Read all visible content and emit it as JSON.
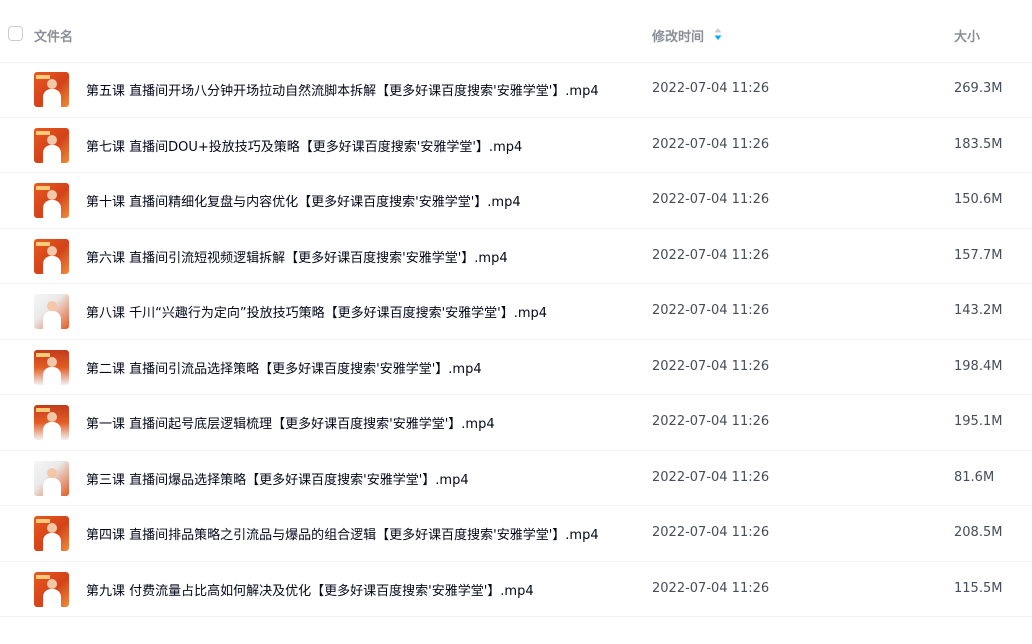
{
  "header": {
    "name_label": "文件名",
    "time_label": "修改时间",
    "size_label": "大小"
  },
  "colors": {
    "sort_active": "#06a7ff",
    "sort_inactive": "#c9ccd3",
    "thumb_orange": "#e35b24"
  },
  "files": [
    {
      "name": "第五课 直播间开场八分钟开场拉动自然流脚本拆解【更多好课百度搜索'安雅学堂'】.mp4",
      "time": "2022-07-04 11:26",
      "size": "269.3M"
    },
    {
      "name": "第七课 直播间DOU+投放技巧及策略【更多好课百度搜索'安雅学堂'】.mp4",
      "time": "2022-07-04 11:26",
      "size": "183.5M"
    },
    {
      "name": "第十课 直播间精细化复盘与内容优化【更多好课百度搜索'安雅学堂'】.mp4",
      "time": "2022-07-04 11:26",
      "size": "150.6M"
    },
    {
      "name": "第六课 直播间引流短视频逻辑拆解【更多好课百度搜索'安雅学堂'】.mp4",
      "time": "2022-07-04 11:26",
      "size": "157.7M"
    },
    {
      "name": "第八课 千川“兴趣行为定向”投放技巧策略【更多好课百度搜索'安雅学堂'】.mp4",
      "time": "2022-07-04 11:26",
      "size": "143.2M"
    },
    {
      "name": "第二课 直播间引流品选择策略【更多好课百度搜索'安雅学堂'】.mp4",
      "time": "2022-07-04 11:26",
      "size": "198.4M"
    },
    {
      "name": "第一课 直播间起号底层逻辑梳理【更多好课百度搜索'安雅学堂'】.mp4",
      "time": "2022-07-04 11:26",
      "size": "195.1M"
    },
    {
      "name": "第三课 直播间爆品选择策略【更多好课百度搜索'安雅学堂'】.mp4",
      "time": "2022-07-04 11:26",
      "size": "81.6M"
    },
    {
      "name": "第四课 直播间排品策略之引流品与爆品的组合逻辑【更多好课百度搜索'安雅学堂'】.mp4",
      "time": "2022-07-04 11:26",
      "size": "208.5M"
    },
    {
      "name": "第九课 付费流量占比高如何解决及优化【更多好课百度搜索'安雅学堂'】.mp4",
      "time": "2022-07-04 11:26",
      "size": "115.5M"
    }
  ]
}
